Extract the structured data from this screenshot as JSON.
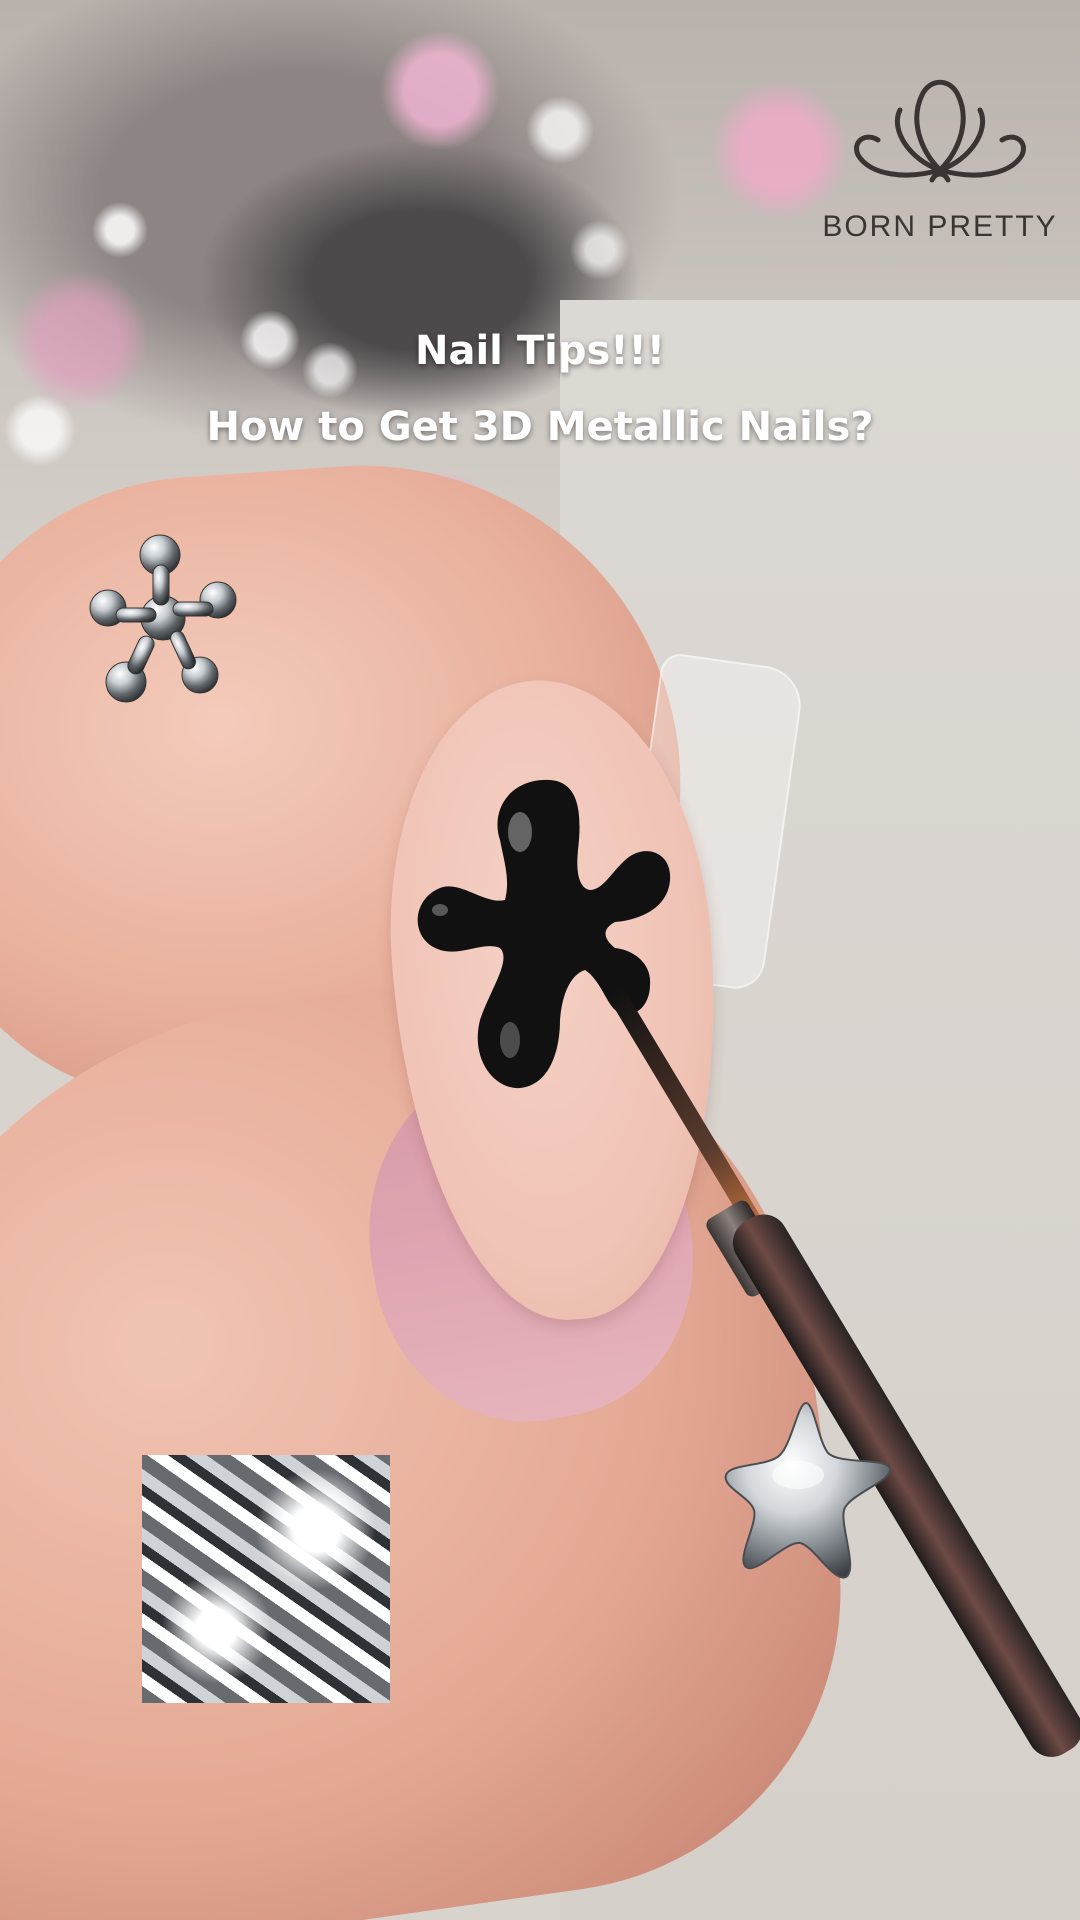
{
  "brand": {
    "name": "BORN PRETTY"
  },
  "caption": {
    "line1": "Nail Tips!!!",
    "line2": "How to Get 3D Metallic Nails?"
  },
  "stickers": {
    "flower_icon": "metallic-flower-charm",
    "star_icon": "metallic-star-charm",
    "swirl_icon": "liquid-chrome-swatch"
  },
  "colors": {
    "nail_base": "#f0c4b6",
    "gel_black": "#111111",
    "caption_text": "#ffffff",
    "logo_text": "#3a3532"
  }
}
